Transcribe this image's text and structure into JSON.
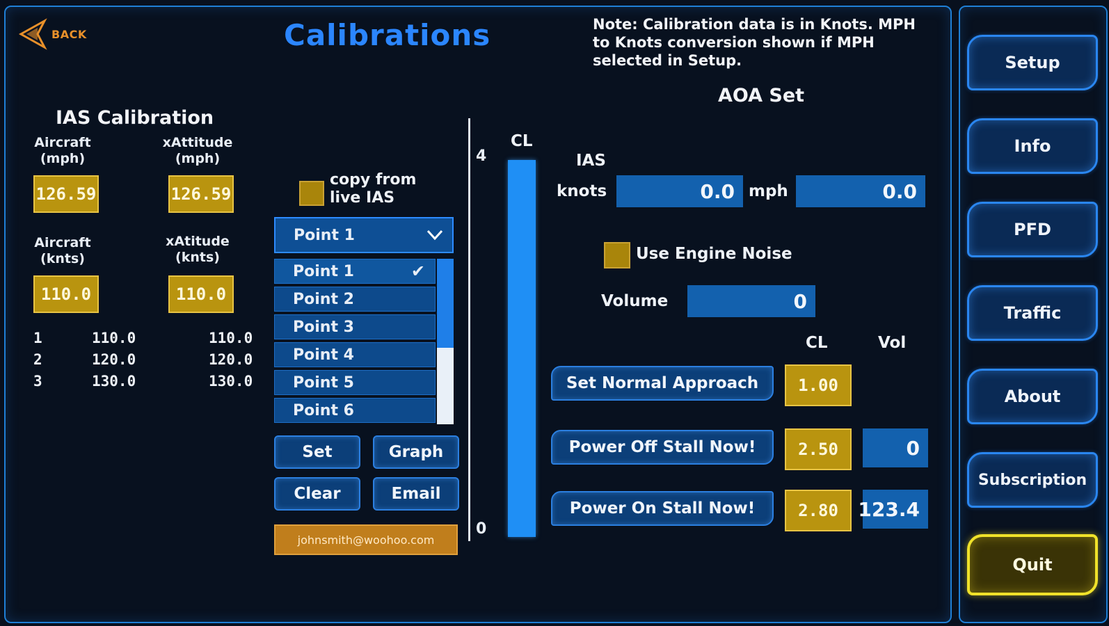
{
  "header": {
    "back_label": "BACK",
    "title": "Calibrations",
    "note": "Note: Calibration  data is in Knots. MPH to Knots conversion  shown if MPH selected in Setup."
  },
  "ias_calibration": {
    "title": "IAS Calibration",
    "aircraft_mph_label": "Aircraft (mph)",
    "xattitude_mph_label": "xAttitude (mph)",
    "aircraft_mph_value": "126.59",
    "xattitude_mph_value": "126.59",
    "aircraft_knts_label": "Aircraft (knts)",
    "xattitude_knts_label": "xAtitude (knts)",
    "aircraft_knts_value": "110.0",
    "xattitude_knts_value": "110.0",
    "rows": [
      {
        "n": "1",
        "aircraft": "110.0",
        "xattitude": "110.0"
      },
      {
        "n": "2",
        "aircraft": "120.0",
        "xattitude": "120.0"
      },
      {
        "n": "3",
        "aircraft": "130.0",
        "xattitude": "130.0"
      }
    ]
  },
  "points": {
    "copy_label": "copy from live IAS",
    "selected": "Point 1",
    "items": [
      "Point 1",
      "Point 2",
      "Point 3",
      "Point 4",
      "Point 5",
      "Point 6"
    ],
    "selected_index": 0,
    "set_label": "Set",
    "graph_label": "Graph",
    "clear_label": "Clear",
    "email_label": "Email",
    "email_value": "johnsmith@woohoo.com",
    "checkmark": "✔"
  },
  "cl_gauge": {
    "label": "CL",
    "max_label": "4",
    "min_label": "0",
    "max": 4,
    "min": 0
  },
  "aoa_set": {
    "title": "AOA Set",
    "ias_label": "IAS",
    "knots_label": "knots",
    "knots_value": "0.0",
    "mph_label": "mph",
    "mph_value": "0.0",
    "engine_noise_label": "Use Engine Noise",
    "volume_label": "Volume",
    "volume_value": "0",
    "cl_col_label": "CL",
    "vol_col_label": "Vol",
    "normal_approach_label": "Set Normal Approach",
    "normal_approach_cl": "1.00",
    "power_off_label": "Power Off Stall Now!",
    "power_off_cl": "2.50",
    "power_off_vol": "0",
    "power_on_label": "Power On Stall Now!",
    "power_on_cl": "2.80",
    "power_on_vol": "123.4"
  },
  "sidebar": {
    "items": [
      "Setup",
      "Info",
      "PFD",
      "Traffic",
      "About",
      "Subscription",
      "Quit"
    ]
  },
  "colors": {
    "accent_blue": "#1f7fd6",
    "title_blue": "#2b86ff",
    "gold": "#b9940f",
    "quit_yellow": "#f0e22a"
  }
}
